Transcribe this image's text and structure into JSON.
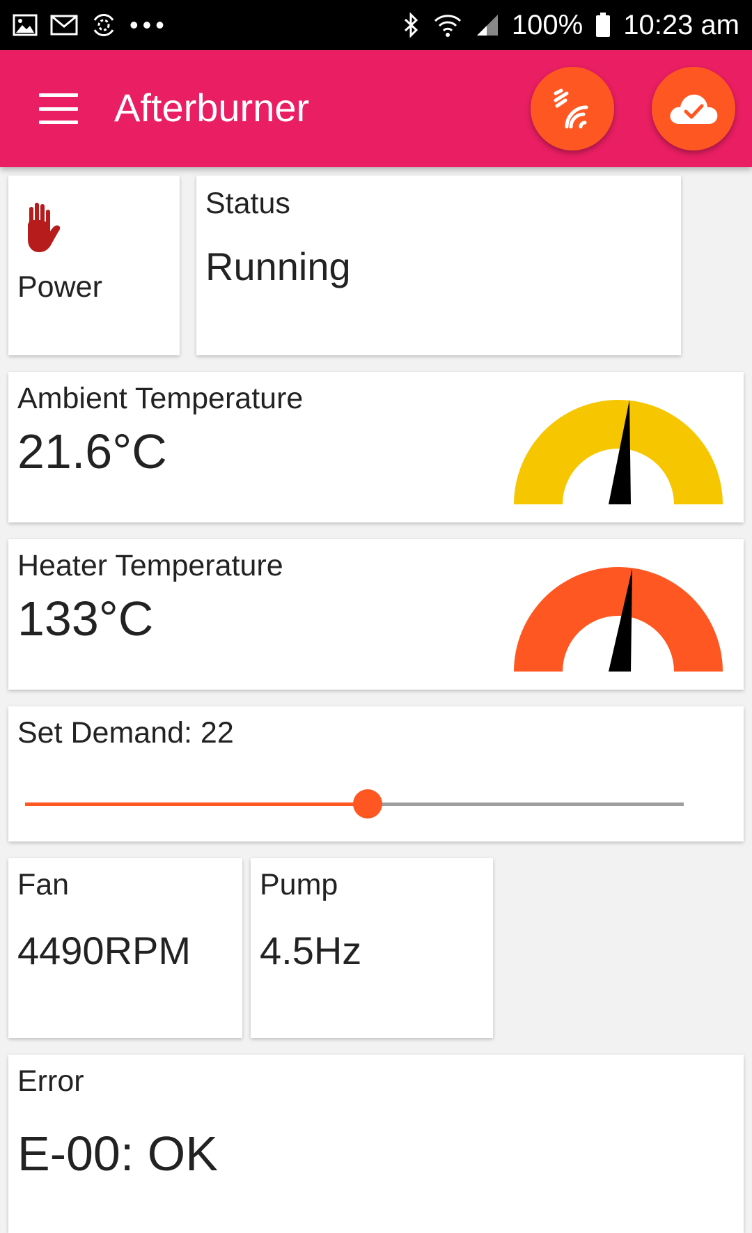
{
  "status_bar": {
    "battery": "100%",
    "time": "10:23 am",
    "icons": [
      "image-icon",
      "gmail-icon",
      "sync-icon",
      "more-dots-icon",
      "bluetooth-icon",
      "wifi-icon",
      "signal-icon",
      "battery-icon"
    ]
  },
  "app_bar": {
    "title": "Afterburner",
    "icons": [
      "menu-icon",
      "bluetooth-connection-icon",
      "cloud-check-icon"
    ]
  },
  "power": {
    "label": "Power",
    "icon": "stop-hand-icon"
  },
  "status": {
    "label": "Status",
    "value": "Running"
  },
  "ambient": {
    "label": "Ambient Temperature",
    "value": "21.6°C",
    "gauge_color": "#f6c700"
  },
  "heater": {
    "label": "Heater Temperature",
    "value": "133°C",
    "gauge_color": "#ff5722"
  },
  "demand": {
    "label": "Set Demand: 22",
    "slider_fraction": 0.52
  },
  "fan": {
    "label": "Fan",
    "value": "4490RPM"
  },
  "pump": {
    "label": "Pump",
    "value": "4.5Hz"
  },
  "error": {
    "label": "Error",
    "value": "E-00: OK"
  },
  "colors": {
    "appbar": "#e91e63",
    "accent": "#ff5722",
    "ambient_gauge": "#f6c700",
    "heater_gauge": "#ff5722",
    "power_icon": "#b71c1c"
  }
}
